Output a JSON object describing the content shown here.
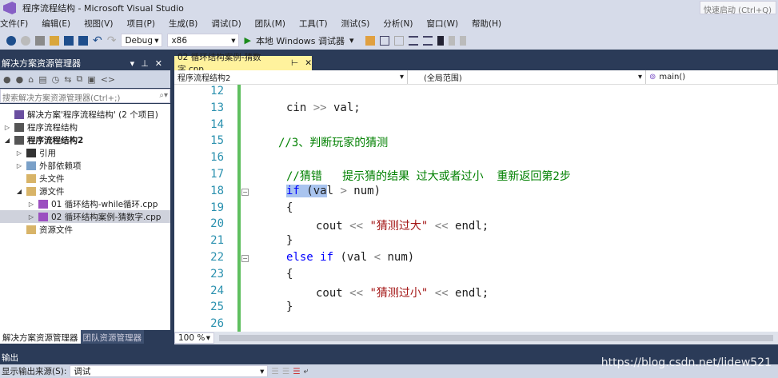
{
  "window": {
    "title": "程序流程结构 - Microsoft Visual Studio",
    "quick_launch": "快速启动 (Ctrl+Q)"
  },
  "menu": [
    "文件(F)",
    "编辑(E)",
    "视图(V)",
    "项目(P)",
    "生成(B)",
    "调试(D)",
    "团队(M)",
    "工具(T)",
    "测试(S)",
    "分析(N)",
    "窗口(W)",
    "帮助(H)"
  ],
  "toolbar": {
    "config": "Debug",
    "platform": "x86",
    "run": "本地 Windows 调试器"
  },
  "solution_explorer": {
    "title": "解决方案资源管理器",
    "search_placeholder": "搜索解决方案资源管理器(Ctrl+;)",
    "nodes": [
      {
        "label": "解决方案'程序流程结构' (2 个项目)",
        "level": 0,
        "arrow": "",
        "icon": "solution-icon"
      },
      {
        "label": "程序流程结构",
        "level": 0,
        "arrow": "▷",
        "icon": "project-icon"
      },
      {
        "label": "程序流程结构2",
        "level": 0,
        "arrow": "◢",
        "icon": "project-icon",
        "bold": true
      },
      {
        "label": "引用",
        "level": 1,
        "arrow": "▷",
        "icon": "references-icon"
      },
      {
        "label": "外部依赖项",
        "level": 1,
        "arrow": "▷",
        "icon": "external-deps-icon"
      },
      {
        "label": "头文件",
        "level": 1,
        "arrow": "",
        "icon": "folder-icon"
      },
      {
        "label": "源文件",
        "level": 1,
        "arrow": "◢",
        "icon": "folder-icon"
      },
      {
        "label": "01 循环结构-while循环.cpp",
        "level": 2,
        "arrow": "▷",
        "icon": "cpp-file-icon"
      },
      {
        "label": "02 循环结构案例-猜数字.cpp",
        "level": 2,
        "arrow": "▷",
        "icon": "cpp-file-icon",
        "selected": true
      },
      {
        "label": "资源文件",
        "level": 1,
        "arrow": "",
        "icon": "folder-icon"
      }
    ],
    "tabs": [
      "解决方案资源管理器",
      "团队资源管理器"
    ]
  },
  "editor": {
    "tab": "02 循环结构案例-猜数字.cpp",
    "nav_project": "程序流程结构2",
    "nav_scope": "(全局范围)",
    "nav_member": "main()",
    "zoom": "100 %",
    "lines": [
      {
        "n": "12",
        "i": 0,
        "s": []
      },
      {
        "n": "13",
        "i": 2,
        "s": [
          {
            "t": "cin ",
            "c": ""
          },
          {
            "t": ">>",
            "c": "op"
          },
          {
            "t": " val;",
            "c": ""
          }
        ]
      },
      {
        "n": "14",
        "i": 0,
        "s": []
      },
      {
        "n": "15",
        "i": 1,
        "s": [
          {
            "t": "//3、判断玩家的猜测",
            "c": "cm"
          }
        ]
      },
      {
        "n": "16",
        "i": 0,
        "s": []
      },
      {
        "n": "17",
        "i": 2,
        "s": [
          {
            "t": "//猜错   提示猜的结果 过大或者过小  重新返回第2步",
            "c": "cm"
          }
        ]
      },
      {
        "n": "18",
        "i": 2,
        "s": [
          {
            "t": "if",
            "c": "kw hl"
          },
          {
            "t": " (va",
            "c": "hl"
          },
          {
            "t": "l ",
            "c": ""
          },
          {
            "t": ">",
            "c": "op"
          },
          {
            "t": " num)",
            "c": ""
          }
        ],
        "fold": true
      },
      {
        "n": "19",
        "i": 2,
        "s": [
          {
            "t": "{",
            "c": ""
          }
        ]
      },
      {
        "n": "20",
        "i": 3,
        "s": [
          {
            "t": "cout ",
            "c": ""
          },
          {
            "t": "<<",
            "c": "op"
          },
          {
            "t": " ",
            "c": ""
          },
          {
            "t": "\"猜测过大\"",
            "c": "str"
          },
          {
            "t": " ",
            "c": ""
          },
          {
            "t": "<<",
            "c": "op"
          },
          {
            "t": " endl;",
            "c": ""
          }
        ]
      },
      {
        "n": "21",
        "i": 2,
        "s": [
          {
            "t": "}",
            "c": ""
          }
        ]
      },
      {
        "n": "22",
        "i": 2,
        "s": [
          {
            "t": "else if",
            "c": "kw"
          },
          {
            "t": " (val ",
            "c": ""
          },
          {
            "t": "<",
            "c": "op"
          },
          {
            "t": " num)",
            "c": ""
          }
        ],
        "fold": true
      },
      {
        "n": "23",
        "i": 2,
        "s": [
          {
            "t": "{",
            "c": ""
          }
        ]
      },
      {
        "n": "24",
        "i": 3,
        "s": [
          {
            "t": "cout ",
            "c": ""
          },
          {
            "t": "<<",
            "c": "op"
          },
          {
            "t": " ",
            "c": ""
          },
          {
            "t": "\"猜测过小\"",
            "c": "str"
          },
          {
            "t": " ",
            "c": ""
          },
          {
            "t": "<<",
            "c": "op"
          },
          {
            "t": " endl;",
            "c": ""
          }
        ]
      },
      {
        "n": "25",
        "i": 2,
        "s": [
          {
            "t": "}",
            "c": ""
          }
        ]
      },
      {
        "n": "26",
        "i": 0,
        "s": []
      }
    ]
  },
  "output": {
    "title": "输出",
    "source_label": "显示输出来源(S):",
    "source_value": "调试"
  },
  "watermark": "https://blog.csdn.net/lidew521"
}
